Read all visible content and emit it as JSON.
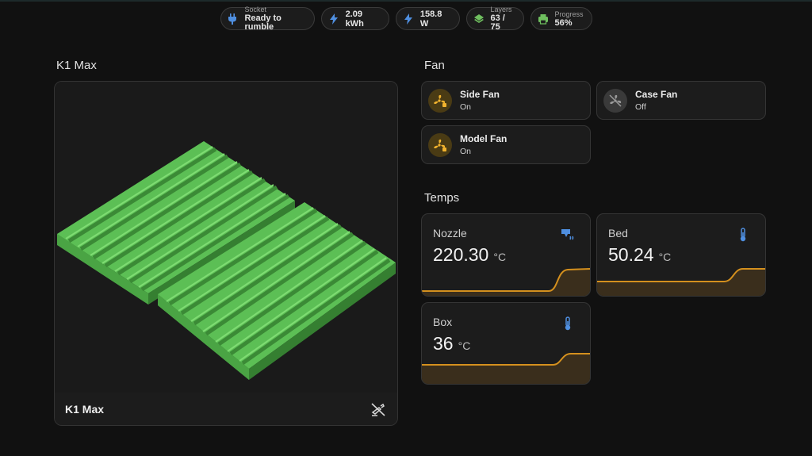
{
  "chips": [
    {
      "id": "socket",
      "label": "Socket",
      "value": "Ready to rumble",
      "icon": "plug-icon"
    },
    {
      "id": "energy",
      "value": "2.09 kWh",
      "icon": "lightning-icon"
    },
    {
      "id": "power",
      "value": "158.8 W",
      "icon": "lightning-icon"
    },
    {
      "id": "layers",
      "label": "Layers",
      "value": "63 / 75",
      "icon": "layers-icon"
    },
    {
      "id": "progress",
      "label": "Progress",
      "value": "56%",
      "icon": "printer-icon"
    }
  ],
  "printer_card": {
    "heading": "K1 Max",
    "title": "K1 Max",
    "footer_icon": "camera-off-icon"
  },
  "fan_section": {
    "heading": "Fan",
    "items": [
      {
        "name": "Side Fan",
        "state": "On"
      },
      {
        "name": "Case Fan",
        "state": "Off"
      },
      {
        "name": "Model Fan",
        "state": "On"
      }
    ]
  },
  "temps_section": {
    "heading": "Temps",
    "items": [
      {
        "name": "Nozzle",
        "value": "220.30",
        "unit": "°C",
        "icon": "nozzle-heat-icon"
      },
      {
        "name": "Bed",
        "value": "50.24",
        "unit": "°C",
        "icon": "thermometer-icon"
      },
      {
        "name": "Box",
        "value": "36",
        "unit": "°C",
        "icon": "thermometer-icon"
      }
    ]
  },
  "colors": {
    "accent": "#d4901e",
    "fan_on": "#f2b32e",
    "icon_blue": "#4f8fe0",
    "model_green": "#66cc66"
  }
}
